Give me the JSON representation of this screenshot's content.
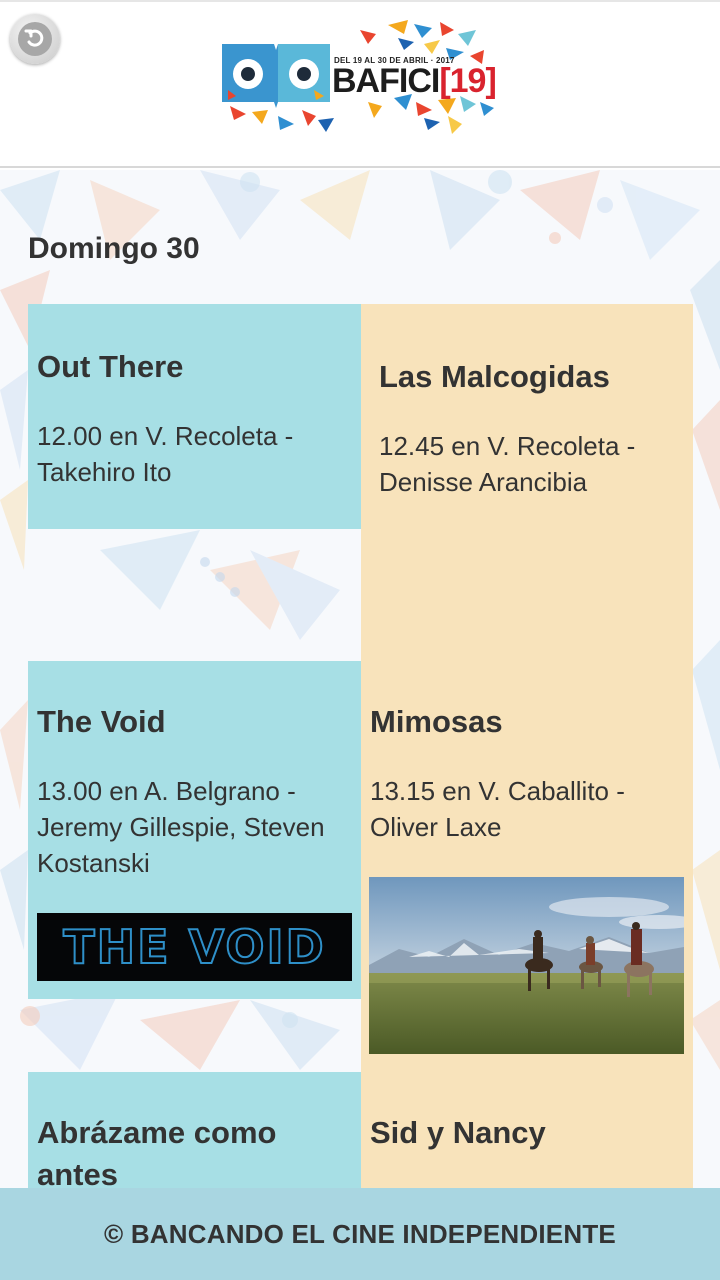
{
  "logo": {
    "dates": "DEL 19 AL 30 DE ABRIL · 2017",
    "name": "BAFICI",
    "edition": "[19]"
  },
  "day": {
    "title": "Domingo 30"
  },
  "screenings": [
    {
      "title": "Out There",
      "details": "12.00 en V. Recoleta - Takehiro Ito"
    },
    {
      "title": "Las Malcogidas",
      "details": "12.45 en V. Recoleta - Denisse Arancibia"
    },
    {
      "title": "The Void",
      "details": "13.00 en A. Belgrano - Jeremy Gillespie, Steven Kostanski",
      "image_text": "THE VOID"
    },
    {
      "title": "Mimosas",
      "details": "13.15 en V. Caballito - Oliver Laxe"
    },
    {
      "title": "Abrázame como antes",
      "details": ""
    },
    {
      "title": "Sid y Nancy",
      "details": ""
    }
  ],
  "footer": {
    "text": "© BANCANDO EL CINE INDEPENDIENTE"
  },
  "colors": {
    "card_blue": "#a7dfe5",
    "card_peach": "#f8e3bb",
    "footer_bg": "#a9d6e1",
    "text": "#333333"
  },
  "icons": {
    "back": "back-arrow-icon"
  }
}
